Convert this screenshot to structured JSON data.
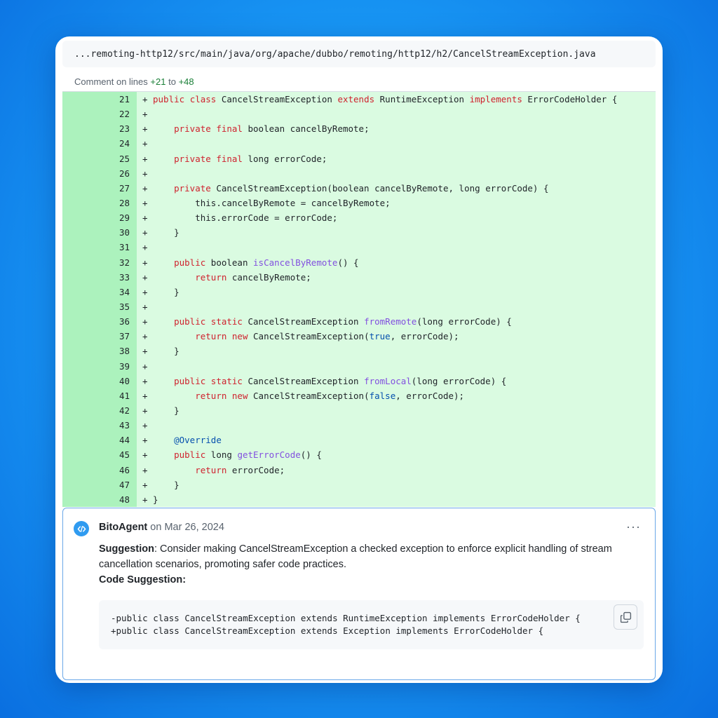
{
  "file": {
    "path": "...remoting-http12/src/main/java/org/apache/dubbo/remoting/http12/h2/CancelStreamException.java"
  },
  "comment_range": {
    "prefix": "Comment on lines",
    "start": "+21",
    "joiner": "to",
    "end": "+48"
  },
  "diff": {
    "lines": [
      {
        "n": "21",
        "code": "public class CancelStreamException extends RuntimeException implements ErrorCodeHolder {"
      },
      {
        "n": "22",
        "code": ""
      },
      {
        "n": "23",
        "code": "    private final boolean cancelByRemote;"
      },
      {
        "n": "24",
        "code": ""
      },
      {
        "n": "25",
        "code": "    private final long errorCode;"
      },
      {
        "n": "26",
        "code": ""
      },
      {
        "n": "27",
        "code": "    private CancelStreamException(boolean cancelByRemote, long errorCode) {"
      },
      {
        "n": "28",
        "code": "        this.cancelByRemote = cancelByRemote;"
      },
      {
        "n": "29",
        "code": "        this.errorCode = errorCode;"
      },
      {
        "n": "30",
        "code": "    }"
      },
      {
        "n": "31",
        "code": ""
      },
      {
        "n": "32",
        "code": "    public boolean isCancelByRemote() {"
      },
      {
        "n": "33",
        "code": "        return cancelByRemote;"
      },
      {
        "n": "34",
        "code": "    }"
      },
      {
        "n": "35",
        "code": ""
      },
      {
        "n": "36",
        "code": "    public static CancelStreamException fromRemote(long errorCode) {"
      },
      {
        "n": "37",
        "code": "        return new CancelStreamException(true, errorCode);"
      },
      {
        "n": "38",
        "code": "    }"
      },
      {
        "n": "39",
        "code": ""
      },
      {
        "n": "40",
        "code": "    public static CancelStreamException fromLocal(long errorCode) {"
      },
      {
        "n": "41",
        "code": "        return new CancelStreamException(false, errorCode);"
      },
      {
        "n": "42",
        "code": "    }"
      },
      {
        "n": "43",
        "code": ""
      },
      {
        "n": "44",
        "code": "    @Override"
      },
      {
        "n": "45",
        "code": "    public long getErrorCode() {"
      },
      {
        "n": "46",
        "code": "        return errorCode;"
      },
      {
        "n": "47",
        "code": "    }"
      },
      {
        "n": "48",
        "code": "}"
      }
    ]
  },
  "comment": {
    "author": "BitoAgent",
    "date_prefix": "on",
    "date": "Mar 26, 2024",
    "more_label": "···",
    "suggestion_label": "Suggestion",
    "suggestion_text": ": Consider making CancelStreamException a checked exception to enforce explicit handling of stream cancellation scenarios, promoting safer code practices.",
    "code_suggestion_label": "Code Suggestion",
    "code_suggestion_colon": ":",
    "code_removed": "-public class CancelStreamException extends RuntimeException implements ErrorCodeHolder {",
    "code_added": "+public class CancelStreamException extends Exception implements ErrorCodeHolder {"
  },
  "colors": {
    "diff_add_bg": "#dafbe1",
    "gutter_add_bg": "#acf2bd",
    "keyword": "#cf222e",
    "function": "#8250df",
    "constant": "#0550ae",
    "comment_border": "#6aa7e8"
  },
  "icons": {
    "avatar": "bito-code-icon",
    "copy": "copy-icon"
  }
}
